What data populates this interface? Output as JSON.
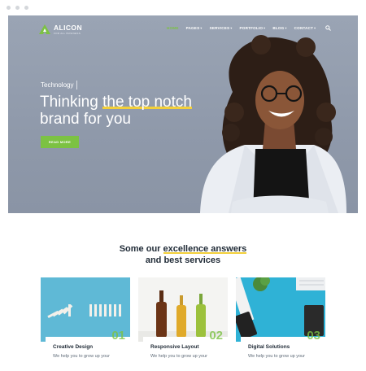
{
  "brand": {
    "name": "ALICON",
    "tagline": "FOR ALL BUSINESS"
  },
  "nav": {
    "items": [
      {
        "label": "HOME",
        "active": true
      },
      {
        "label": "PAGES",
        "dropdown": true
      },
      {
        "label": "SERVICES",
        "dropdown": true
      },
      {
        "label": "PORTFOLIO",
        "dropdown": true
      },
      {
        "label": "BLOG",
        "dropdown": true
      },
      {
        "label": "CONTACT",
        "dropdown": true
      }
    ],
    "search_icon": "search-icon"
  },
  "hero": {
    "eyebrow": "Technology",
    "headline_pre": "Thinking ",
    "headline_highlight": "the top notch",
    "headline_line2": "brand for you",
    "button_label": "READ MORE"
  },
  "services": {
    "title_pre": "Some our ",
    "title_highlight": "excellence answers",
    "title_line2": "and best services",
    "cards": [
      {
        "number": "01",
        "title": "Creative Design",
        "desc": "We help you to grow up your"
      },
      {
        "number": "02",
        "title": "Responsive Layout",
        "desc": "We help you to grow up your"
      },
      {
        "number": "03",
        "title": "Digital Solutions",
        "desc": "We help you to grow up your"
      }
    ]
  },
  "colors": {
    "accent": "#7cc243",
    "highlight": "#f2cf3a",
    "hero_bg": "#949eae",
    "dark_text": "#1f2a36"
  }
}
